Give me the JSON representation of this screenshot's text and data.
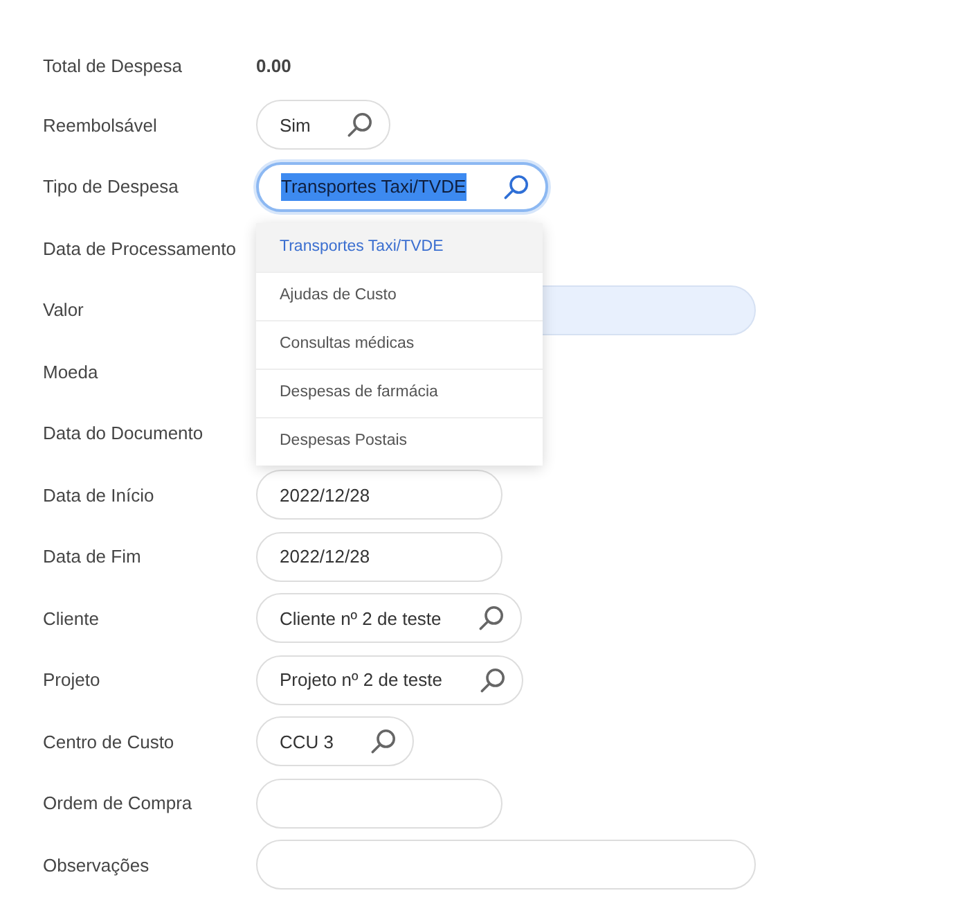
{
  "form": {
    "fields": [
      {
        "label": "Total de Despesa",
        "kind": "readonly",
        "value": "0.00"
      },
      {
        "label": "Reembolsável",
        "kind": "lookup",
        "value": "Sim",
        "focused": false
      },
      {
        "label": "Tipo de Despesa",
        "kind": "lookup",
        "value": "Transportes Taxi/TVDE",
        "focused": true,
        "dropdown": {
          "options": [
            {
              "label": "Transportes Taxi/TVDE",
              "selected": true
            },
            {
              "label": "Ajudas de Custo",
              "selected": false
            },
            {
              "label": "Consultas médicas",
              "selected": false
            },
            {
              "label": "Despesas de farmácia",
              "selected": false
            },
            {
              "label": "Despesas Postais",
              "selected": false
            }
          ]
        }
      },
      {
        "label": "Data de Processamento"
      },
      {
        "label": "Valor",
        "kind": "amount",
        "focused": false
      },
      {
        "label": "Moeda"
      },
      {
        "label": "Data do Documento"
      },
      {
        "label": "Data de Início",
        "kind": "date",
        "value": "2022/12/28",
        "focused": false
      },
      {
        "label": "Data de Fim",
        "kind": "date",
        "value": "2022/12/28",
        "focused": false
      },
      {
        "label": "Cliente",
        "kind": "lookup",
        "value": "Cliente nº 2 de teste",
        "focused": false
      },
      {
        "label": "Projeto",
        "kind": "lookup",
        "value": "Projeto nº 2 de teste",
        "focused": false
      },
      {
        "label": "Centro de Custo",
        "kind": "lookup",
        "value": "CCU 3",
        "focused": false
      },
      {
        "label": "Ordem de Compra",
        "kind": "text",
        "focused": false
      },
      {
        "label": "Observações",
        "kind": "memo",
        "focused": false
      }
    ]
  }
}
